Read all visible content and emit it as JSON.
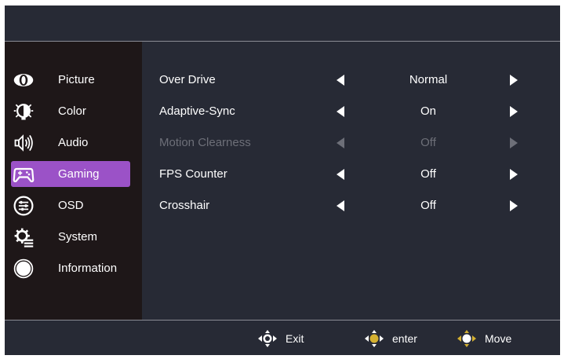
{
  "sidebar": {
    "items": [
      {
        "label": "Picture",
        "icon": "eye-icon"
      },
      {
        "label": "Color",
        "icon": "color-bulb-icon"
      },
      {
        "label": "Audio",
        "icon": "speaker-icon"
      },
      {
        "label": "Gaming",
        "icon": "gamepad-icon",
        "active": true
      },
      {
        "label": "OSD",
        "icon": "osd-sliders-icon"
      },
      {
        "label": "System",
        "icon": "system-gear-icon"
      },
      {
        "label": "Information",
        "icon": "info-circle-icon"
      }
    ]
  },
  "settings": [
    {
      "label": "Over Drive",
      "value": "Normal",
      "enabled": true
    },
    {
      "label": "Adaptive-Sync",
      "value": "On",
      "enabled": true
    },
    {
      "label": "Motion Clearness",
      "value": "Off",
      "enabled": false
    },
    {
      "label": "FPS Counter",
      "value": "Off",
      "enabled": true
    },
    {
      "label": "Crosshair",
      "value": "Off",
      "enabled": true
    }
  ],
  "footer": {
    "exit_label": "Exit",
    "enter_label": "enter",
    "move_label": "Move"
  },
  "colors": {
    "background": "#272a35",
    "sidebar": "#1e1718",
    "active": "#9b52c7",
    "disabled_text": "#6d6f78",
    "joystick_center": "#d4b030"
  }
}
